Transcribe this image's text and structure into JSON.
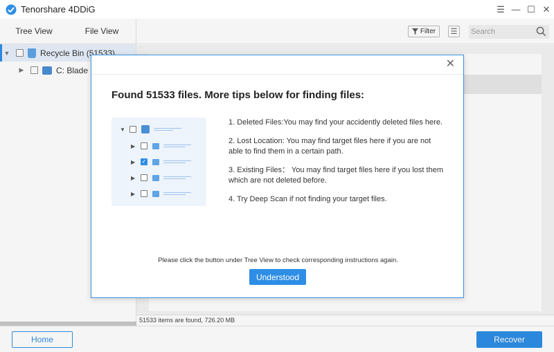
{
  "app": {
    "title": "Tenorshare 4DDiG",
    "controls": [
      "restore-icon",
      "minimize-icon",
      "maximize-icon",
      "close-icon"
    ]
  },
  "left": {
    "tabs": [
      "Tree View",
      "File View"
    ],
    "tree": [
      {
        "label": "Recycle Bin (51533)",
        "icon": "recycle-bin-icon",
        "expanded": true,
        "selected": true
      },
      {
        "label": "C: Blade",
        "icon": "drive-icon",
        "expanded": false,
        "selected": false
      }
    ]
  },
  "toolbar": {
    "filter_label": "Filter",
    "search_placeholder": "Search"
  },
  "status": {
    "text": "51533 items are found, 726.20 MB"
  },
  "bottom": {
    "home_label": "Home",
    "recover_label": "Recover"
  },
  "modal": {
    "title": "Found 51533 files. More tips below for finding files:",
    "tips": [
      "1. Deleted Files:You may find your accidently deleted files here.",
      "2. Lost Location: You may find target files here if you are not able to find them in a certain path.",
      "3. Existing Files： You may find target files here if you lost them which are not deleted before.",
      "4. Try Deep Scan if not finding your target files."
    ],
    "hint": "Please click the button under Tree View to check corresponding instructions again.",
    "button_label": "Understood"
  },
  "colors": {
    "accent": "#2e8ee5",
    "selection": "#e8f1fb"
  }
}
